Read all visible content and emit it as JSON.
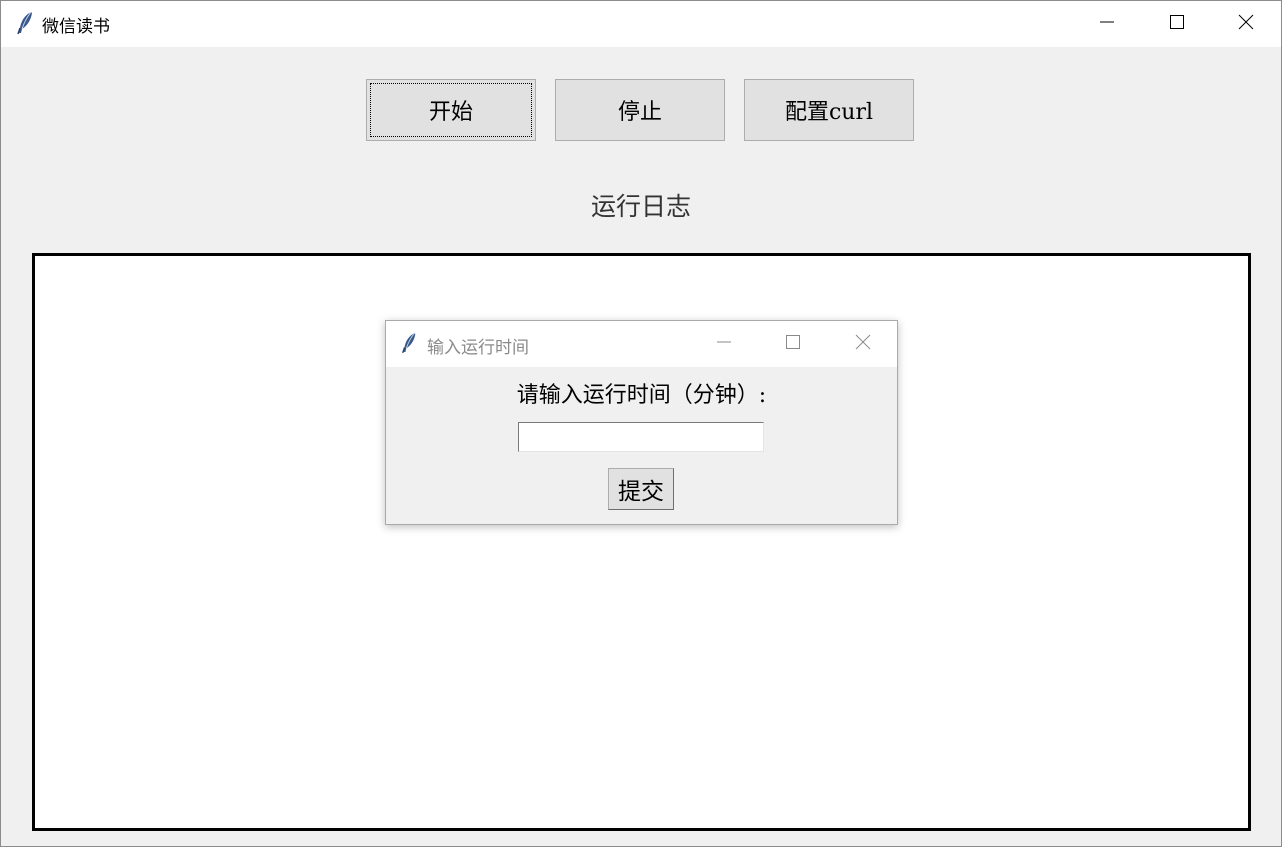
{
  "main_window": {
    "title": "微信读书",
    "icon": "feather-icon",
    "controls": {
      "minimize": "minimize-icon",
      "maximize": "maximize-icon",
      "close": "close-icon"
    }
  },
  "toolbar": {
    "start_label": "开始",
    "stop_label": "停止",
    "config_label": "配置curl"
  },
  "log": {
    "title": "运行日志",
    "content": ""
  },
  "dialog": {
    "title": "输入运行时间",
    "icon": "feather-icon",
    "prompt": "请输入运行时间（分钟）:",
    "input_value": "",
    "submit_label": "提交"
  }
}
